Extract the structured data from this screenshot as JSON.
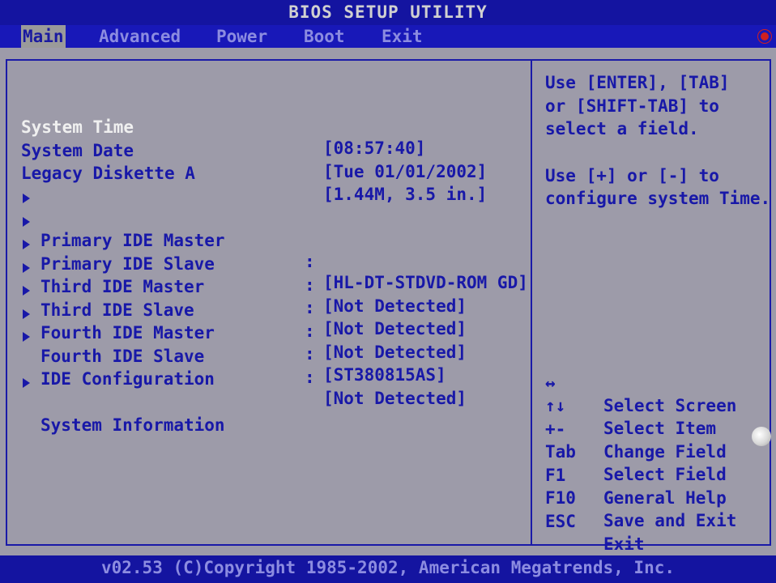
{
  "title": "BIOS SETUP UTILITY",
  "menu": [
    {
      "label": "Main",
      "active": true
    },
    {
      "label": "Advanced",
      "active": false
    },
    {
      "label": "Power",
      "active": false
    },
    {
      "label": "Boot",
      "active": false
    },
    {
      "label": "Exit",
      "active": false
    }
  ],
  "settings": {
    "system_time": {
      "label": "System Time",
      "value": "[08:57:40]"
    },
    "system_date": {
      "label": "System Date",
      "value": "[Tue 01/01/2002]"
    },
    "legacy_diskette": {
      "label": "Legacy Diskette A",
      "value": "[1.44M, 3.5 in.]"
    }
  },
  "devices": [
    {
      "label": "Primary IDE Master",
      "sep": ":",
      "value": "[HL-DT-STDVD-ROM GD]"
    },
    {
      "label": "Primary IDE Slave",
      "sep": ":",
      "value": "[Not Detected]"
    },
    {
      "label": "Third IDE Master",
      "sep": ":",
      "value": "[Not Detected]"
    },
    {
      "label": "Third IDE Slave",
      "sep": ":",
      "value": "[Not Detected]"
    },
    {
      "label": "Fourth IDE Master",
      "sep": ":",
      "value": "[ST380815AS]"
    },
    {
      "label": "Fourth IDE Slave",
      "sep": ":",
      "value": "[Not Detected]"
    }
  ],
  "submenus": {
    "ide_config": "IDE Configuration",
    "system_info": "System Information"
  },
  "help": [
    "Use [ENTER], [TAB]",
    "or [SHIFT-TAB] to",
    "select a field.",
    "",
    "Use [+] or [-] to",
    "configure system Time."
  ],
  "keys": [
    {
      "key": "↔",
      "desc": "Select Screen"
    },
    {
      "key": "↑↓",
      "desc": "Select Item"
    },
    {
      "key": "+-",
      "desc": "Change Field"
    },
    {
      "key": "Tab",
      "desc": "Select Field"
    },
    {
      "key": "F1",
      "desc": "General Help"
    },
    {
      "key": "F10",
      "desc": "Save and Exit"
    },
    {
      "key": "ESC",
      "desc": "Exit"
    }
  ],
  "footer": "v02.53 (C)Copyright 1985-2002, American Megatrends, Inc.",
  "colors": {
    "background_panel": "#9d9ba9",
    "title_bar": "#1414a0",
    "text_blue": "#1818a8",
    "selected_text": "#f0f0f0"
  }
}
